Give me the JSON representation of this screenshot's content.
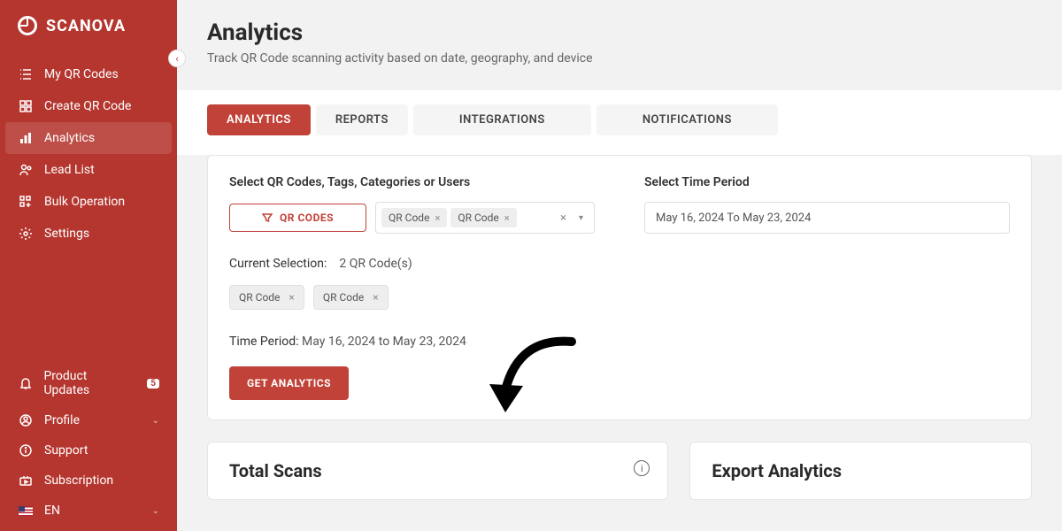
{
  "brand": "SCANOVA",
  "sidebar": {
    "items": [
      {
        "label": "My QR Codes"
      },
      {
        "label": "Create QR Code"
      },
      {
        "label": "Analytics"
      },
      {
        "label": "Lead List"
      },
      {
        "label": "Bulk Operation"
      },
      {
        "label": "Settings"
      }
    ],
    "bottom": [
      {
        "label": "Product Updates",
        "badge": "5"
      },
      {
        "label": "Profile"
      },
      {
        "label": "Support"
      },
      {
        "label": "Subscription"
      }
    ],
    "lang": "EN"
  },
  "header": {
    "title": "Analytics",
    "subtitle": "Track QR Code scanning activity based on date, geography, and device"
  },
  "tabs": [
    "ANALYTICS",
    "REPORTS",
    "INTEGRATIONS",
    "NOTIFICATIONS"
  ],
  "filter": {
    "label_qr": "Select QR Codes, Tags, Categories or Users",
    "label_time": "Select Time Period",
    "qr_button": "QR CODES",
    "selected_chips": [
      "QR Code",
      "QR Code"
    ],
    "date_range": "May 16, 2024 To May 23, 2024",
    "current_label": "Current Selection:",
    "current_value": "2 QR Code(s)",
    "chip2": [
      "QR Code",
      "QR Code"
    ],
    "tp_label": "Time Period:",
    "tp_value": "May 16, 2024 to May 23, 2024",
    "get_button": "GET ANALYTICS"
  },
  "cards": {
    "total_scans": "Total Scans",
    "export": "Export Analytics"
  }
}
